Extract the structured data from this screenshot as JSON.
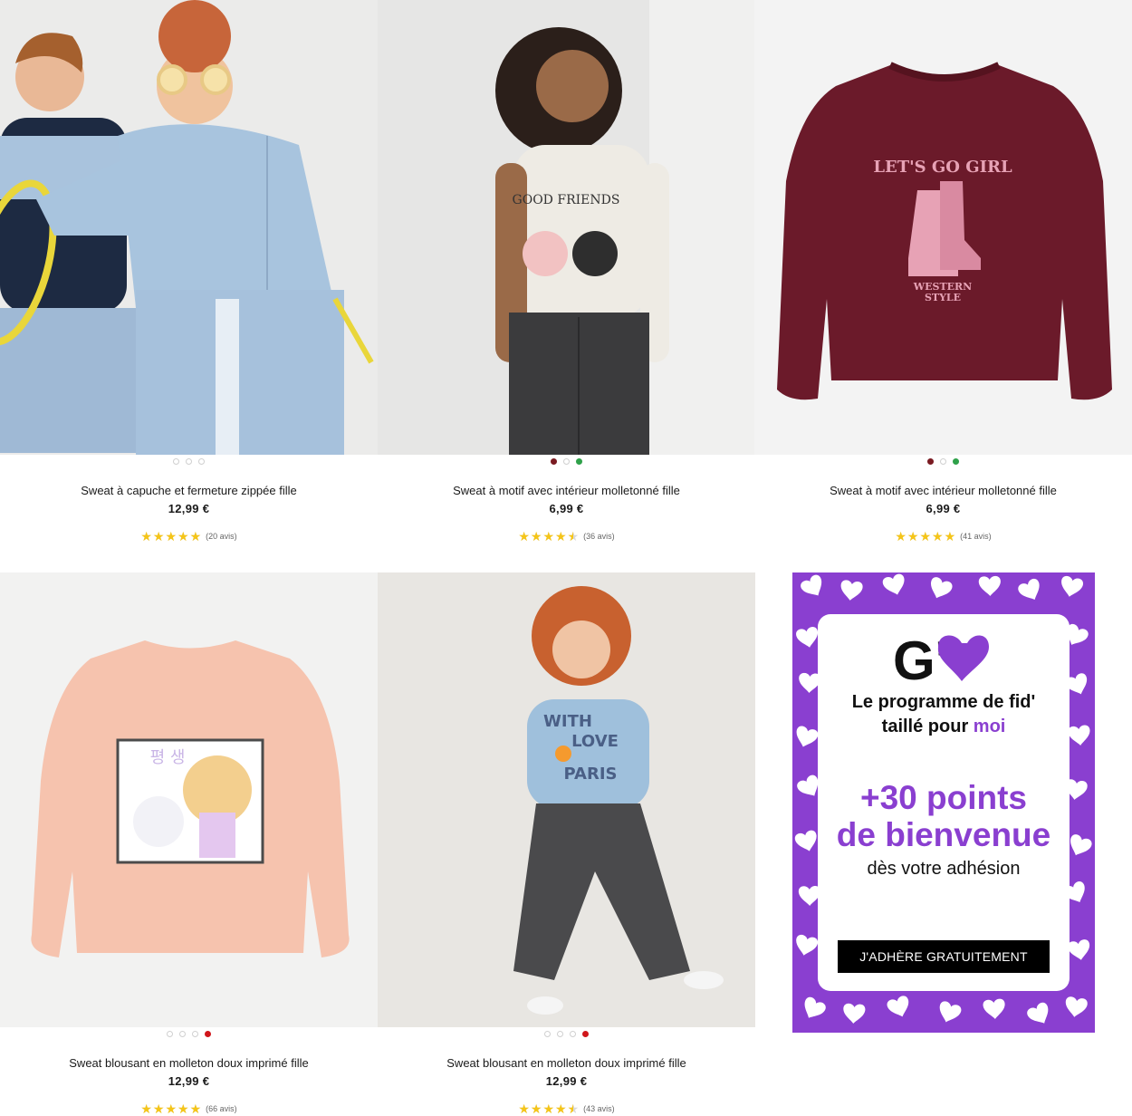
{
  "products": [
    {
      "name": "Sweat à capuche et fermeture zippée fille",
      "price": "12,99 €",
      "rating": 5,
      "reviews": "(20 avis)",
      "swatches": [
        "#ffffff",
        "#ffffff",
        "#ffffff"
      ],
      "image_desc": "two-kids-light-blue-tracksuit-photo"
    },
    {
      "name": "Sweat à motif avec intérieur molletonné fille",
      "price": "6,99 €",
      "rating": 4.5,
      "reviews": "(36 avis)",
      "swatches": [
        "#7a1b22",
        "#ffffff",
        "#2fa14a"
      ],
      "image_desc": "girl-cream-sweatshirt-photo"
    },
    {
      "name": "Sweat à motif avec intérieur molletonné fille",
      "price": "6,99 €",
      "rating": 5,
      "reviews": "(41 avis)",
      "swatches": [
        "#7a1b22",
        "#ffffff",
        "#2fa14a"
      ],
      "image_desc": "burgundy-sweatshirt-product"
    },
    {
      "name": "Sweat blousant en molleton doux imprimé fille",
      "price": "12,99 €",
      "rating": 5,
      "reviews": "(66 avis)",
      "swatches": [
        "#ffffff",
        "#ffffff",
        "#ffffff",
        "#d0161b"
      ],
      "image_desc": "pink-sweatshirt-product"
    },
    {
      "name": "Sweat blousant en molleton doux imprimé fille",
      "price": "12,99 €",
      "rating": 4.5,
      "reviews": "(43 avis)",
      "swatches": [
        "#ffffff",
        "#ffffff",
        "#ffffff",
        "#d0161b"
      ],
      "image_desc": "girl-blue-sweatshirt-photo"
    }
  ],
  "artwork": {
    "p3_line1": "LET'S GO GIRL",
    "p3_line2": "WESTERN",
    "p3_line3": "STYLE",
    "p2_text": "GOOD FRIENDS",
    "p5_line1": "WITH",
    "p5_line2": "LOVE",
    "p5_line3": "PARIS"
  },
  "promo": {
    "logo": "G'",
    "title_line1": "Le programme de fid'",
    "title_line2_a": "taillé pour ",
    "title_line2_b": "moi",
    "points_line1": "+30 points",
    "points_line2": "de bienvenue",
    "subtitle": "dès votre adhésion",
    "button": "J'ADHÈRE GRATUITEMENT"
  },
  "colors": {
    "star": "#f5c518",
    "promo_purple": "#8a3fd0",
    "burgundy": "#6b1a2a"
  }
}
